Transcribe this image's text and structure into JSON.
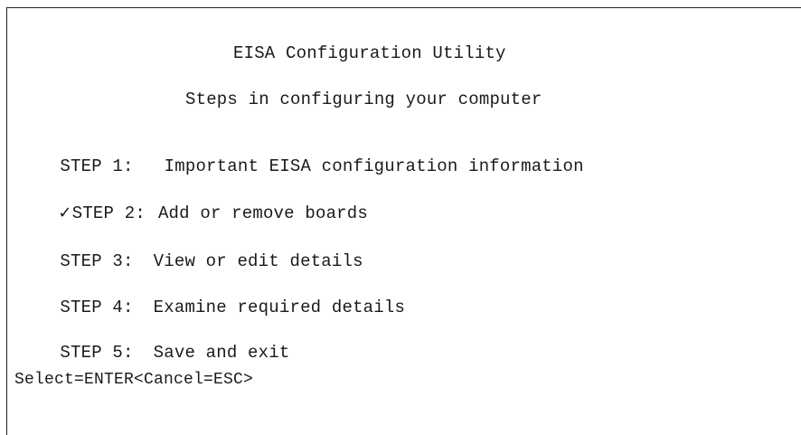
{
  "app": {
    "title": "EISA Configuration Utility",
    "subtitle": "Steps in configuring your computer"
  },
  "steps": [
    {
      "label": "STEP 1:",
      "text": "Important EISA configuration information",
      "checked": false
    },
    {
      "label": "STEP 2:",
      "text": "Add or remove boards",
      "checked": true,
      "check_icon": "check-icon",
      "check_glyph": "✓"
    },
    {
      "label": "STEP 3:",
      "text": "View or edit details",
      "checked": false
    },
    {
      "label": "STEP 4:",
      "text": "Examine required details",
      "checked": false
    },
    {
      "label": "STEP 5:",
      "text": "Save and exit",
      "checked": false
    }
  ],
  "footer": {
    "keys": "Select=ENTER<Cancel=ESC>"
  },
  "colors": {
    "background": "#ffffff",
    "text": "#1a1a1a",
    "border": "#222222"
  }
}
